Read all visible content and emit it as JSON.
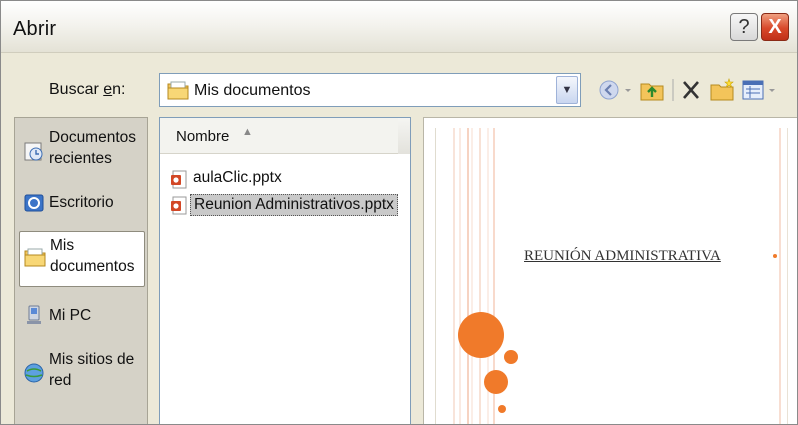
{
  "window": {
    "title": "Abrir"
  },
  "titlebar": {
    "help_label": "?",
    "close_label": "X"
  },
  "lookin": {
    "label_prefix": "Buscar ",
    "label_accel": "e",
    "label_suffix": "n:",
    "value": "Mis documentos"
  },
  "places": [
    {
      "line1": "Documentos",
      "line2": "recientes",
      "icon": "recent-documents-icon"
    },
    {
      "line1": "Escritorio",
      "line2": "",
      "icon": "desktop-icon"
    },
    {
      "line1": "Mis",
      "line2": "documentos",
      "icon": "my-documents-icon",
      "selected": true
    },
    {
      "line1": "Mi PC",
      "line2": "",
      "icon": "my-computer-icon"
    },
    {
      "line1": "Mis sitios de",
      "line2": "red",
      "icon": "network-places-icon"
    }
  ],
  "filelist": {
    "column_name": "Nombre",
    "files": [
      {
        "name": "aulaClic.pptx",
        "icon": "pptx-file-icon",
        "selected": false
      },
      {
        "name": "Reunion Administrativos.pptx",
        "icon": "pptx-file-icon",
        "selected": true
      }
    ]
  },
  "preview": {
    "slide_title": "REUNIÓN ADMINISTRATIVA",
    "accent_color": "#f07a2a"
  }
}
